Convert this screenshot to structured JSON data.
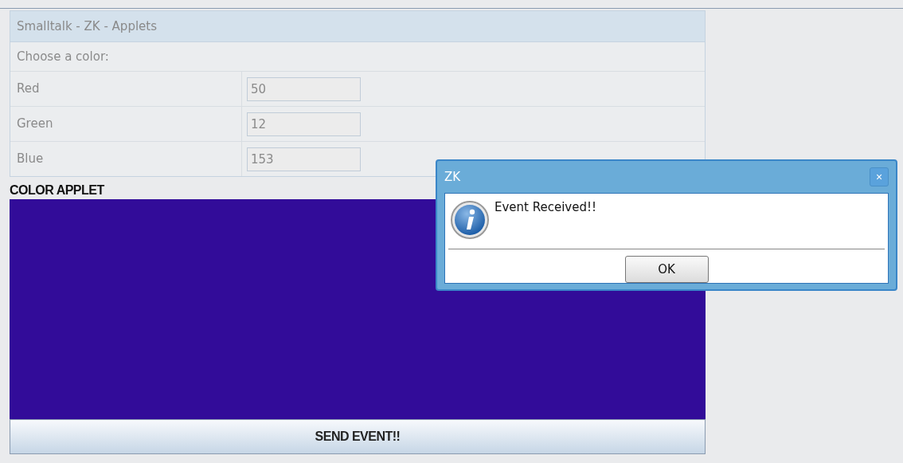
{
  "panel": {
    "title": "Smalltalk - ZK - Applets",
    "prompt": "Choose a color:",
    "fields": [
      {
        "label": "Red",
        "value": "50"
      },
      {
        "label": "Green",
        "value": "12"
      },
      {
        "label": "Blue",
        "value": "153"
      }
    ]
  },
  "applet": {
    "title": "COLOR APPLET",
    "button": "SEND EVENT!!"
  },
  "dialog": {
    "title": "ZK",
    "close": "×",
    "message": "Event Received!!",
    "button": "OK"
  }
}
